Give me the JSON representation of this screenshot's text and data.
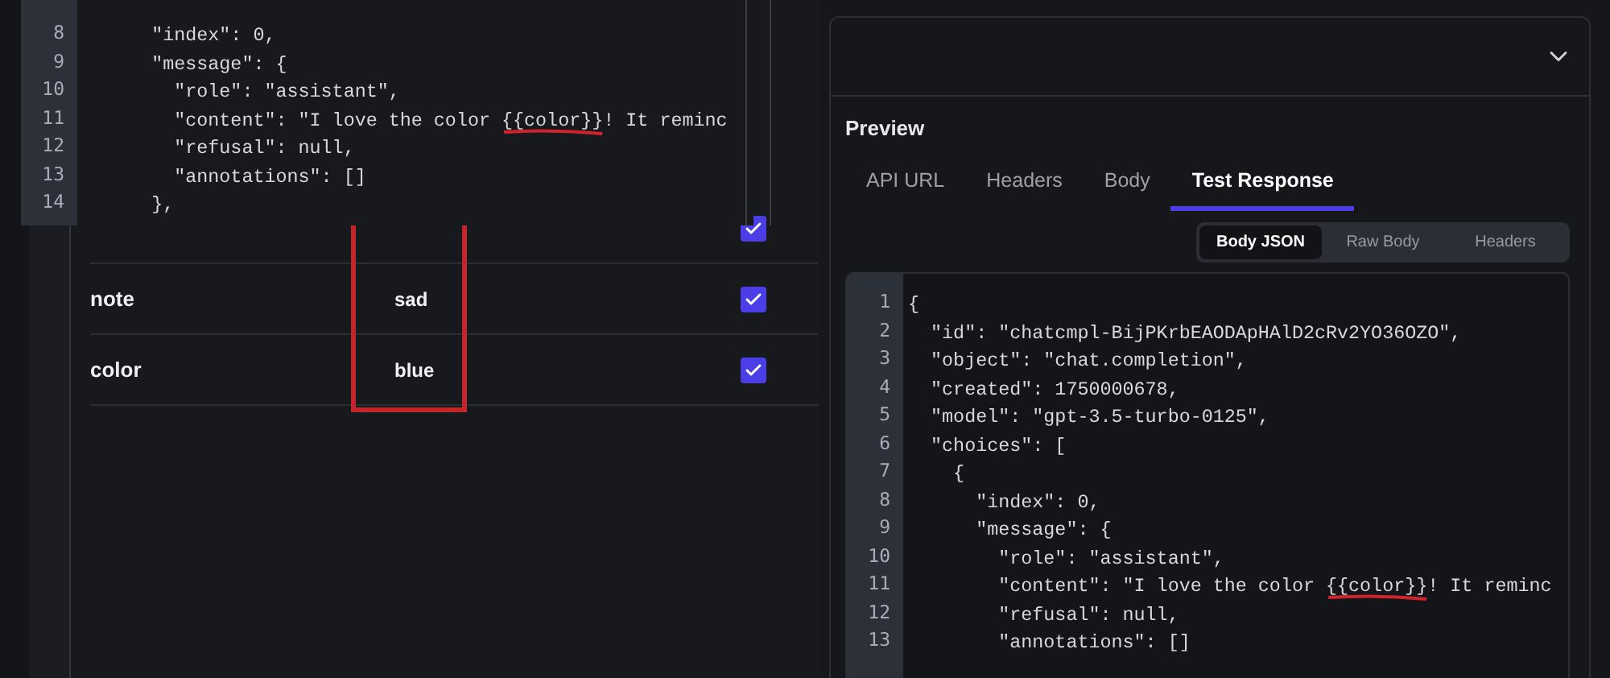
{
  "variables": {
    "rows": [
      {
        "checked": true
      },
      {
        "name": "note",
        "value": "sad",
        "checked": true
      },
      {
        "name": "color",
        "value": "blue",
        "checked": true
      }
    ]
  },
  "overlay_code": {
    "lines": [
      {
        "number": "8",
        "text": "      \"index\": 0,"
      },
      {
        "number": "9",
        "text": "      \"message\": {"
      },
      {
        "number": "10",
        "text": "        \"role\": \"assistant\","
      },
      {
        "number": "11",
        "text": "        \"content\": \"I love the color {{color}}! It reminc",
        "underlined": true
      },
      {
        "number": "12",
        "text": "        \"refusal\": null,"
      },
      {
        "number": "13",
        "text": "        \"annotations\": []"
      },
      {
        "number": "14",
        "text": "      },"
      }
    ]
  },
  "preview": {
    "title": "Preview",
    "tabs": [
      {
        "label": "API URL",
        "selected": false
      },
      {
        "label": "Headers",
        "selected": false
      },
      {
        "label": "Body",
        "selected": false
      },
      {
        "label": "Test Response",
        "selected": true
      }
    ],
    "body_views": [
      {
        "label": "Body JSON",
        "selected": true
      },
      {
        "label": "Raw Body",
        "selected": false
      },
      {
        "label": "Headers",
        "selected": false
      }
    ],
    "code": {
      "lines": [
        {
          "number": "1",
          "text": "{"
        },
        {
          "number": "2",
          "text": "  \"id\": \"chatcmpl-BijPKrbEAODApHAlD2cRv2YO36OZO\","
        },
        {
          "number": "3",
          "text": "  \"object\": \"chat.completion\","
        },
        {
          "number": "4",
          "text": "  \"created\": 1750000678,"
        },
        {
          "number": "5",
          "text": "  \"model\": \"gpt-3.5-turbo-0125\","
        },
        {
          "number": "6",
          "text": "  \"choices\": ["
        },
        {
          "number": "7",
          "text": "    {"
        },
        {
          "number": "8",
          "text": "      \"index\": 0,"
        },
        {
          "number": "9",
          "text": "      \"message\": {"
        },
        {
          "number": "10",
          "text": "        \"role\": \"assistant\","
        },
        {
          "number": "11",
          "text": "        \"content\": \"I love the color {{color}}! It reminc",
          "underlined": true
        },
        {
          "number": "12",
          "text": "        \"refusal\": null,"
        },
        {
          "number": "13",
          "text": "        \"annotations\": []"
        }
      ]
    }
  }
}
